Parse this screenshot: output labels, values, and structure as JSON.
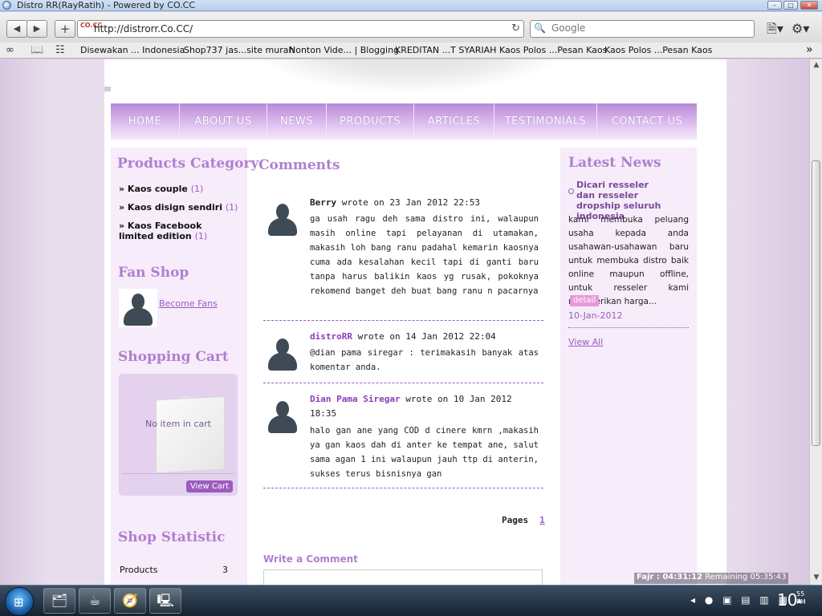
{
  "window": {
    "title": "Distro RR(RayRatih) - Powered by CO.CC",
    "minimize_glyph": "–",
    "maximize_glyph": "□",
    "close_glyph": "✕"
  },
  "toolbar": {
    "back_glyph": "◀",
    "forward_glyph": "▶",
    "add_glyph": "+",
    "favicon_text": "CO.CC",
    "url": "http://distrorr.Co.CC/",
    "reload_glyph": "↻",
    "search_icon": "🔍",
    "search_placeholder": "Google",
    "page_menu_glyph": "🗎▾",
    "settings_glyph": "⚙▾"
  },
  "bookmarks": {
    "reader_icon": "∞",
    "book_icon": "📖",
    "grid_icon": "☷",
    "items": [
      "Disewakan ... Indonesia",
      "Shop737 jas...site murah",
      "Nonton Vide... | Blogging",
      "KREDITAN ...T SYARIAH",
      "Kaos Polos ...Pesan Kaos",
      "Kaos Polos ...Pesan Kaos"
    ],
    "more_glyph": "»"
  },
  "nav": {
    "items": [
      "HOME",
      "ABOUT US",
      "NEWS",
      "PRODUCTS",
      "ARTICLES",
      "TESTIMONIALS",
      "CONTACT US"
    ]
  },
  "sidebar_left": {
    "categories_title": "Products Category",
    "categories": [
      {
        "label": "» Kaos couple",
        "count": "(1)"
      },
      {
        "label": "» Kaos disign sendiri",
        "count": "(1)"
      },
      {
        "label": "» Kaos Facebook limited edition",
        "count": "(1)"
      }
    ],
    "fan_title": "Fan Shop",
    "fan_link": "Become Fans",
    "cart_title": "Shopping Cart",
    "cart_empty": "No item in cart",
    "cart_button": "View Cart",
    "stat_title": "Shop Statistic",
    "stats": [
      {
        "label": "Products",
        "value": "3"
      }
    ]
  },
  "main": {
    "comments_title": "Comments",
    "comments": [
      {
        "author": "Berry",
        "meta": "wrote on 23 Jan 2012 22:53",
        "text": "ga usah ragu deh sama distro ini, walaupun masih online tapi pelayanan di utamakan, makasih loh bang ranu padahal kemarin kaosnya cuma ada kesalahan kecil tapi di ganti baru tanpa harus balikin kaos yg rusak, pokoknya rekomend banget deh buat bang ranu n pacarnya"
      },
      {
        "author": "distroRR",
        "meta": "wrote on 14 Jan 2012 22:04",
        "text": "@dian pama siregar : terimakasih banyak atas komentar anda."
      },
      {
        "author": "Dian Pama Siregar",
        "meta": "wrote on 10 Jan 2012 18:35",
        "text": "halo gan ane yang COD d cinere kmrn ,makasih ya gan kaos dah di anter ke tempat ane, salut sama agan 1 ini walaupun jauh ttp di anterin, sukses terus bisnisnya gan"
      }
    ],
    "pages_label": "Pages",
    "page_number": "1",
    "write_comment": "Write a Comment"
  },
  "sidebar_right": {
    "title": "Latest News",
    "news_title": "Dicari resseler dan resseler dropship seluruh indonesia",
    "news_body": "kami membuka peluang usaha kepada anda usahawan-usahawan baru untuk membuka distro baik online maupun offline, untuk resseler kami memberikan harga...",
    "detail": "detail",
    "date": "10-Jan-2012",
    "view_all": "View All"
  },
  "prayer": {
    "label": "Fajr : 04:31:12",
    "remaining": "Remaining 05:35:43"
  },
  "scrollbar": {
    "up_glyph": "▲",
    "down_glyph": "▼"
  },
  "taskbar": {
    "start_glyph": "⊞",
    "tasks": [
      "🗂",
      "☕",
      "🧭",
      "🖳"
    ],
    "tray_glyphs": "◂ ● ▣ ▤ ▥ ▦ ▴",
    "clock": "10",
    "clock_min": "55",
    "clock_ampm": "PM"
  }
}
